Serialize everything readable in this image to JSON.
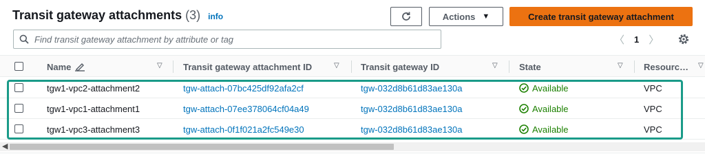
{
  "header": {
    "title": "Transit gateway attachments",
    "count": "(3)",
    "info": "info",
    "actions_label": "Actions",
    "create_label": "Create transit gateway attachment"
  },
  "search": {
    "placeholder": "Find transit gateway attachment by attribute or tag"
  },
  "pagination": {
    "current_page": "1"
  },
  "table": {
    "columns": {
      "name": "Name",
      "attachment_id": "Transit gateway attachment ID",
      "gateway_id": "Transit gateway ID",
      "state": "State",
      "resource": "Resourc…"
    },
    "rows": [
      {
        "name": "tgw1-vpc2-attachment2",
        "attachment_id": "tgw-attach-07bc425df92afa2cf",
        "gateway_id": "tgw-032d8b61d83ae130a",
        "state": "Available",
        "resource": "VPC"
      },
      {
        "name": "tgw1-vpc1-attachment1",
        "attachment_id": "tgw-attach-07ee378064cf04a49",
        "gateway_id": "tgw-032d8b61d83ae130a",
        "state": "Available",
        "resource": "VPC"
      },
      {
        "name": "tgw1-vpc3-attachment3",
        "attachment_id": "tgw-attach-0f1f021a2fc549e30",
        "gateway_id": "tgw-032d8b61d83ae130a",
        "state": "Available",
        "resource": "VPC"
      }
    ]
  },
  "colors": {
    "primary_button": "#ec7211",
    "link": "#0073bb",
    "available": "#1d8102",
    "highlight": "#1a9b89"
  },
  "icons": [
    "refresh-icon",
    "caret-down-icon",
    "search-icon",
    "chevron-left-icon",
    "chevron-right-icon",
    "gear-icon",
    "edit-icon",
    "sort-icon",
    "status-available-icon"
  ]
}
